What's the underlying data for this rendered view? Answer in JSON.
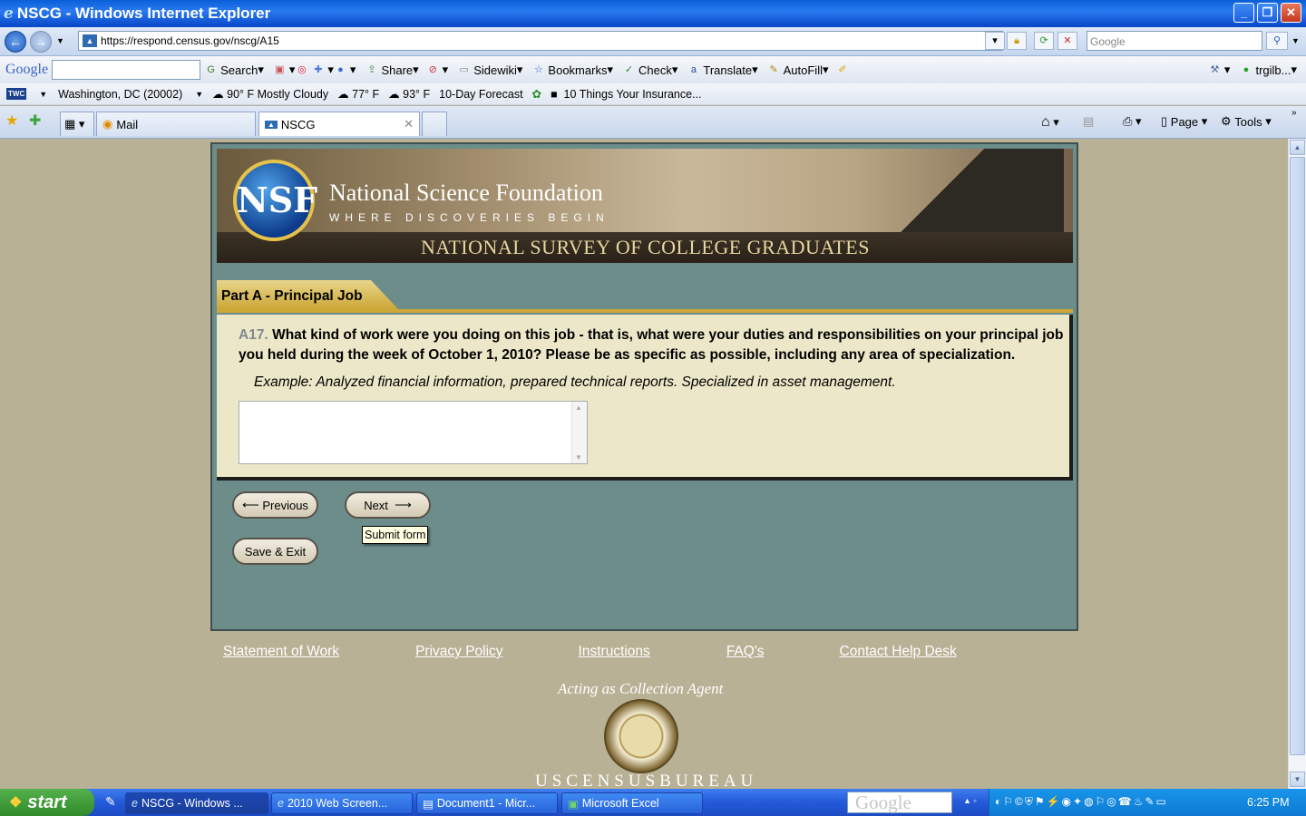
{
  "window": {
    "title": "NSCG - Windows Internet Explorer",
    "minimize": "_",
    "maximize": "❐",
    "close": "✕"
  },
  "address": {
    "url": "https://respond.census.gov/nscg/A15",
    "search_placeholder": "Google"
  },
  "google_toolbar": {
    "logo": "Google",
    "items": [
      "Search",
      "Share",
      "Sidewiki",
      "Bookmarks",
      "Check",
      "Translate",
      "AutoFill"
    ],
    "account": "trgilb..."
  },
  "weather_toolbar": {
    "brand": "TWC",
    "location": "Washington, DC (20002)",
    "current": "90° F Mostly Cloudy",
    "temp1": "77° F",
    "temp2": "93° F",
    "forecast": "10-Day Forecast",
    "news": "10 Things Your Insurance..."
  },
  "tabs": [
    {
      "label": "Mail"
    },
    {
      "label": "NSCG"
    }
  ],
  "commands": {
    "page": "Page",
    "tools": "Tools"
  },
  "banner": {
    "logo_text": "NSF",
    "org": "National Science Foundation",
    "tagline": "WHERE DISCOVERIES BEGIN",
    "survey": "NATIONAL SURVEY OF COLLEGE GRADUATES"
  },
  "section": {
    "title": "Part A - Principal Job"
  },
  "question": {
    "number": "A17.",
    "text": "What kind of work were you doing on this job - that is, what were your duties and responsibilities on your principal job you held during the week of October 1, 2010? Please be as specific as possible, including any area of specialization.",
    "example": "Example: Analyzed financial information, prepared technical reports. Specialized in asset management.",
    "answer": ""
  },
  "buttons": {
    "previous": "Previous",
    "next": "Next",
    "save_exit": "Save & Exit",
    "tooltip": "Submit form"
  },
  "footer": {
    "links": [
      "Statement of Work",
      "Privacy Policy",
      "Instructions",
      "FAQ's",
      "Contact Help Desk"
    ],
    "agent": "Acting as Collection Agent",
    "bureau": "USCENSUSBUREAU"
  },
  "taskbar": {
    "start": "start",
    "tasks": [
      "NSCG - Windows ...",
      "2010 Web Screen...",
      "Document1 - Micr...",
      "Microsoft Excel"
    ],
    "google_desktop": "Google",
    "clock": "6:25 PM"
  }
}
